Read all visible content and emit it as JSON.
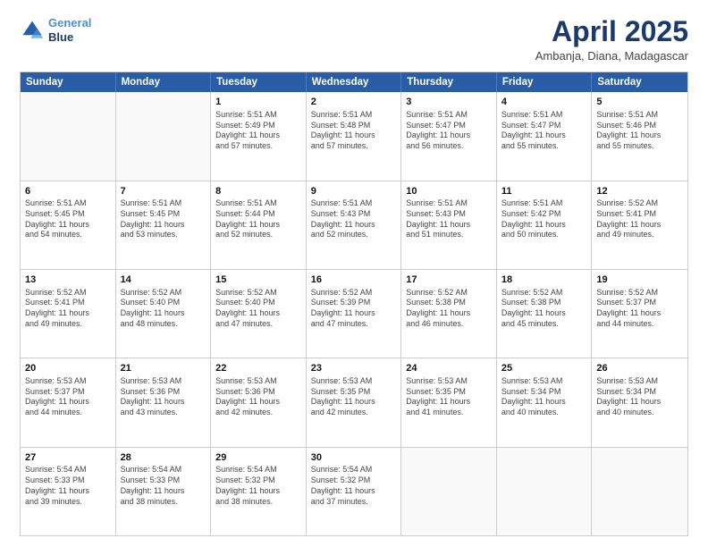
{
  "header": {
    "logo_line1": "General",
    "logo_line2": "Blue",
    "month_title": "April 2025",
    "location": "Ambanja, Diana, Madagascar"
  },
  "days": [
    "Sunday",
    "Monday",
    "Tuesday",
    "Wednesday",
    "Thursday",
    "Friday",
    "Saturday"
  ],
  "rows": [
    [
      {
        "day": "",
        "lines": []
      },
      {
        "day": "",
        "lines": []
      },
      {
        "day": "1",
        "lines": [
          "Sunrise: 5:51 AM",
          "Sunset: 5:49 PM",
          "Daylight: 11 hours",
          "and 57 minutes."
        ]
      },
      {
        "day": "2",
        "lines": [
          "Sunrise: 5:51 AM",
          "Sunset: 5:48 PM",
          "Daylight: 11 hours",
          "and 57 minutes."
        ]
      },
      {
        "day": "3",
        "lines": [
          "Sunrise: 5:51 AM",
          "Sunset: 5:47 PM",
          "Daylight: 11 hours",
          "and 56 minutes."
        ]
      },
      {
        "day": "4",
        "lines": [
          "Sunrise: 5:51 AM",
          "Sunset: 5:47 PM",
          "Daylight: 11 hours",
          "and 55 minutes."
        ]
      },
      {
        "day": "5",
        "lines": [
          "Sunrise: 5:51 AM",
          "Sunset: 5:46 PM",
          "Daylight: 11 hours",
          "and 55 minutes."
        ]
      }
    ],
    [
      {
        "day": "6",
        "lines": [
          "Sunrise: 5:51 AM",
          "Sunset: 5:45 PM",
          "Daylight: 11 hours",
          "and 54 minutes."
        ]
      },
      {
        "day": "7",
        "lines": [
          "Sunrise: 5:51 AM",
          "Sunset: 5:45 PM",
          "Daylight: 11 hours",
          "and 53 minutes."
        ]
      },
      {
        "day": "8",
        "lines": [
          "Sunrise: 5:51 AM",
          "Sunset: 5:44 PM",
          "Daylight: 11 hours",
          "and 52 minutes."
        ]
      },
      {
        "day": "9",
        "lines": [
          "Sunrise: 5:51 AM",
          "Sunset: 5:43 PM",
          "Daylight: 11 hours",
          "and 52 minutes."
        ]
      },
      {
        "day": "10",
        "lines": [
          "Sunrise: 5:51 AM",
          "Sunset: 5:43 PM",
          "Daylight: 11 hours",
          "and 51 minutes."
        ]
      },
      {
        "day": "11",
        "lines": [
          "Sunrise: 5:51 AM",
          "Sunset: 5:42 PM",
          "Daylight: 11 hours",
          "and 50 minutes."
        ]
      },
      {
        "day": "12",
        "lines": [
          "Sunrise: 5:52 AM",
          "Sunset: 5:41 PM",
          "Daylight: 11 hours",
          "and 49 minutes."
        ]
      }
    ],
    [
      {
        "day": "13",
        "lines": [
          "Sunrise: 5:52 AM",
          "Sunset: 5:41 PM",
          "Daylight: 11 hours",
          "and 49 minutes."
        ]
      },
      {
        "day": "14",
        "lines": [
          "Sunrise: 5:52 AM",
          "Sunset: 5:40 PM",
          "Daylight: 11 hours",
          "and 48 minutes."
        ]
      },
      {
        "day": "15",
        "lines": [
          "Sunrise: 5:52 AM",
          "Sunset: 5:40 PM",
          "Daylight: 11 hours",
          "and 47 minutes."
        ]
      },
      {
        "day": "16",
        "lines": [
          "Sunrise: 5:52 AM",
          "Sunset: 5:39 PM",
          "Daylight: 11 hours",
          "and 47 minutes."
        ]
      },
      {
        "day": "17",
        "lines": [
          "Sunrise: 5:52 AM",
          "Sunset: 5:38 PM",
          "Daylight: 11 hours",
          "and 46 minutes."
        ]
      },
      {
        "day": "18",
        "lines": [
          "Sunrise: 5:52 AM",
          "Sunset: 5:38 PM",
          "Daylight: 11 hours",
          "and 45 minutes."
        ]
      },
      {
        "day": "19",
        "lines": [
          "Sunrise: 5:52 AM",
          "Sunset: 5:37 PM",
          "Daylight: 11 hours",
          "and 44 minutes."
        ]
      }
    ],
    [
      {
        "day": "20",
        "lines": [
          "Sunrise: 5:53 AM",
          "Sunset: 5:37 PM",
          "Daylight: 11 hours",
          "and 44 minutes."
        ]
      },
      {
        "day": "21",
        "lines": [
          "Sunrise: 5:53 AM",
          "Sunset: 5:36 PM",
          "Daylight: 11 hours",
          "and 43 minutes."
        ]
      },
      {
        "day": "22",
        "lines": [
          "Sunrise: 5:53 AM",
          "Sunset: 5:36 PM",
          "Daylight: 11 hours",
          "and 42 minutes."
        ]
      },
      {
        "day": "23",
        "lines": [
          "Sunrise: 5:53 AM",
          "Sunset: 5:35 PM",
          "Daylight: 11 hours",
          "and 42 minutes."
        ]
      },
      {
        "day": "24",
        "lines": [
          "Sunrise: 5:53 AM",
          "Sunset: 5:35 PM",
          "Daylight: 11 hours",
          "and 41 minutes."
        ]
      },
      {
        "day": "25",
        "lines": [
          "Sunrise: 5:53 AM",
          "Sunset: 5:34 PM",
          "Daylight: 11 hours",
          "and 40 minutes."
        ]
      },
      {
        "day": "26",
        "lines": [
          "Sunrise: 5:53 AM",
          "Sunset: 5:34 PM",
          "Daylight: 11 hours",
          "and 40 minutes."
        ]
      }
    ],
    [
      {
        "day": "27",
        "lines": [
          "Sunrise: 5:54 AM",
          "Sunset: 5:33 PM",
          "Daylight: 11 hours",
          "and 39 minutes."
        ]
      },
      {
        "day": "28",
        "lines": [
          "Sunrise: 5:54 AM",
          "Sunset: 5:33 PM",
          "Daylight: 11 hours",
          "and 38 minutes."
        ]
      },
      {
        "day": "29",
        "lines": [
          "Sunrise: 5:54 AM",
          "Sunset: 5:32 PM",
          "Daylight: 11 hours",
          "and 38 minutes."
        ]
      },
      {
        "day": "30",
        "lines": [
          "Sunrise: 5:54 AM",
          "Sunset: 5:32 PM",
          "Daylight: 11 hours",
          "and 37 minutes."
        ]
      },
      {
        "day": "",
        "lines": []
      },
      {
        "day": "",
        "lines": []
      },
      {
        "day": "",
        "lines": []
      }
    ]
  ]
}
